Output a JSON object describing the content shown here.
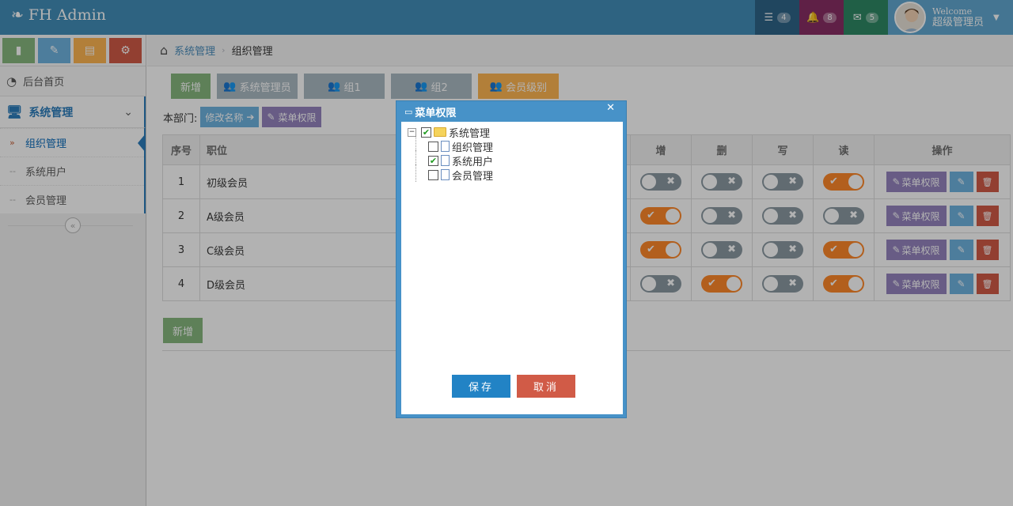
{
  "navbar": {
    "brand": "FH Admin",
    "tasks_count": "4",
    "notifications_count": "8",
    "messages_count": "5",
    "welcome": "Welcome",
    "username": "超级管理员"
  },
  "sidebar": {
    "items": [
      {
        "label": "后台首页"
      },
      {
        "label": "系统管理"
      }
    ],
    "submenu": [
      {
        "label": "组织管理"
      },
      {
        "label": "系统用户"
      },
      {
        "label": "会员管理"
      }
    ]
  },
  "breadcrumb": {
    "parent": "系统管理",
    "current": "组织管理"
  },
  "tabs": {
    "add": "新增",
    "items": [
      "系统管理员",
      "组1",
      "组2",
      "会员级别"
    ]
  },
  "dept": {
    "label": "本部门:",
    "rename": "修改名称",
    "menu_perm": "菜单权限"
  },
  "table": {
    "headers": {
      "idx": "序号",
      "role": "职位",
      "add": "增",
      "del": "删",
      "write": "写",
      "read": "读",
      "ops": "操作"
    },
    "rows": [
      {
        "idx": "1",
        "name": "初级会员",
        "add": false,
        "del": false,
        "write": false,
        "read": true
      },
      {
        "idx": "2",
        "name": "A级会员",
        "add": true,
        "del": false,
        "write": false,
        "read": false
      },
      {
        "idx": "3",
        "name": "C级会员",
        "add": true,
        "del": false,
        "write": false,
        "read": true
      },
      {
        "idx": "4",
        "name": "D级会员",
        "add": false,
        "del": true,
        "write": false,
        "read": true
      }
    ],
    "op_label": "菜单权限"
  },
  "bottom_add": "新增",
  "dialog": {
    "title": "菜单权限",
    "tree": {
      "root": {
        "label": "系统管理",
        "checked": true
      },
      "children": [
        {
          "label": "组织管理",
          "checked": false
        },
        {
          "label": "系统用户",
          "checked": true
        },
        {
          "label": "会员管理",
          "checked": false
        }
      ]
    },
    "save": "保存",
    "cancel": "取消"
  },
  "colors": {
    "navbar": "#438eb9",
    "switch_on": "#ff892a",
    "switch_off": "#8b9aa3",
    "dialog_frame": "#4792c8"
  }
}
